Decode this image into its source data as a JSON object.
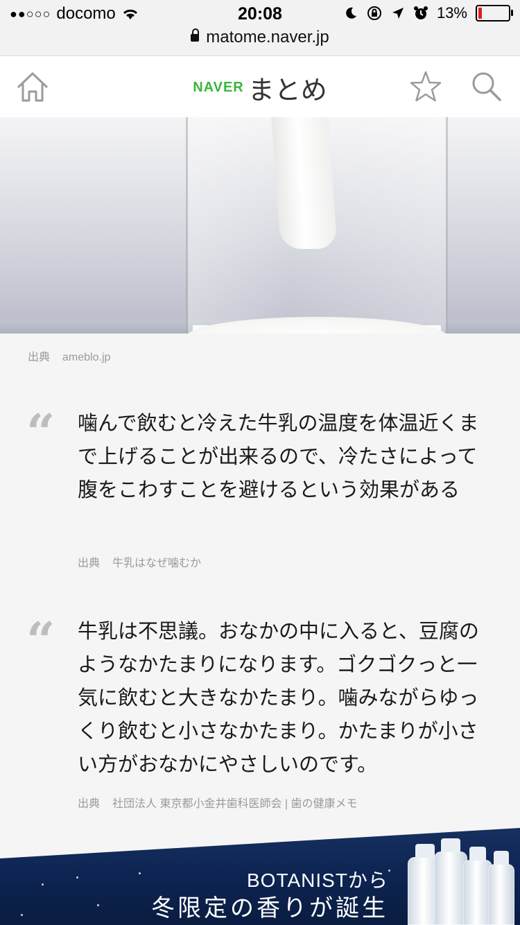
{
  "status_bar": {
    "signal_dots": "●●○○○",
    "carrier": "docomo",
    "time": "20:08",
    "battery": "13%",
    "battery_level": 0.13
  },
  "browser": {
    "url": "matome.naver.jp"
  },
  "header": {
    "logo_naver": "NAVER",
    "logo_matome": "まとめ",
    "brand_color": "#3cb53c"
  },
  "hero_caption": {
    "label": "出典",
    "source": "ameblo.jp"
  },
  "quotes": [
    {
      "mark": "“",
      "text": "噛んで飲むと冷えた牛乳の温度を体温近くまで上げることが出来るので、冷たさによって腹をこわすことを避けるという効果がある",
      "source_label": "出典",
      "source": "牛乳はなぜ噛むか"
    },
    {
      "mark": "“",
      "text": "牛乳は不思議。おなかの中に入ると、豆腐のようなかたまりになります。ゴクゴクっと一気に飲むと大きなかたまり。噛みながらゆっくり飲むと小さなかたまり。かたまりが小さい方がおなかにやさしいのです。",
      "source_label": "出典",
      "source": "社団法人 東京都小金井歯科医師会 | 歯の健康メモ"
    }
  ],
  "ad": {
    "line1": "BOTANISTから",
    "line2": "冬限定の香りが誕生"
  }
}
